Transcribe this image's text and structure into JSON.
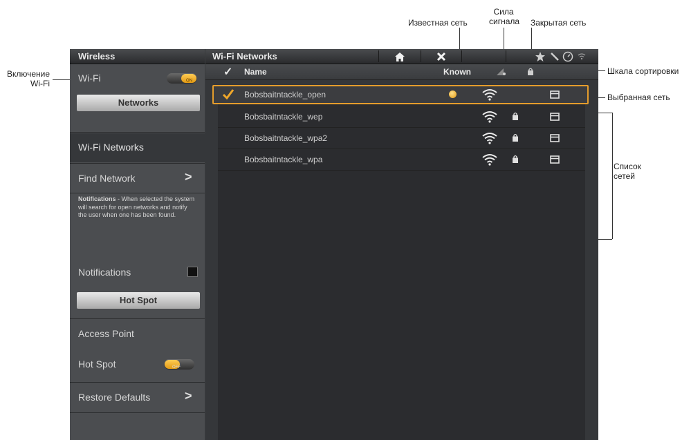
{
  "annotations": {
    "known_network": "Известная сеть",
    "signal_strength": "Сила\nсигнала",
    "closed_network": "Закрытая сеть",
    "wifi_toggle": "Включение\nWi-Fi",
    "sort_bar": "Шкала сортировки",
    "selected_network": "Выбранная сеть",
    "network_list": "Список\nсетей"
  },
  "left_panel": {
    "title": "Wireless",
    "wifi_label": "Wi-Fi",
    "wifi_toggle": {
      "state": "on",
      "small_label": "ON"
    },
    "networks_header": "Networks",
    "wifi_networks_label": "Wi-Fi Networks",
    "find_network_label": "Find Network",
    "notifications_desc_bold": "Notifications",
    "notifications_desc": " - When selected the system will search for open networks and notify the user when one has been found.",
    "notifications_label": "Notifications",
    "hotspot_header": "Hot Spot",
    "access_point_label": "Access Point",
    "hotspot_label": "Hot Spot",
    "hotspot_toggle": {
      "state": "off",
      "small_label": "OFF"
    },
    "restore_defaults_label": "Restore Defaults",
    "chevron": ">"
  },
  "right_panel": {
    "title": "Wi-Fi Networks",
    "home_icon": "home-icon",
    "close_icon": "close-icon",
    "header_icons": [
      "star-icon",
      "tools-icon",
      "compass-icon",
      "wifi-small-icon"
    ],
    "sort_bar": {
      "check": "✓",
      "name": "Name",
      "known": "Known",
      "signal_icon": "signal-sort-icon",
      "lock_icon": "lock-sort-icon"
    },
    "networks": [
      {
        "name": "Bobsbaitntackle_open",
        "known": true,
        "locked": false,
        "selected": true
      },
      {
        "name": "Bobsbaitntackle_wep",
        "known": false,
        "locked": true,
        "selected": false
      },
      {
        "name": "Bobsbaitntackle_wpa2",
        "known": false,
        "locked": true,
        "selected": false
      },
      {
        "name": "Bobsbaitntackle_wpa",
        "known": false,
        "locked": true,
        "selected": false
      }
    ]
  },
  "colors": {
    "accent": "#e59d2c",
    "check": "#f0a72a"
  }
}
